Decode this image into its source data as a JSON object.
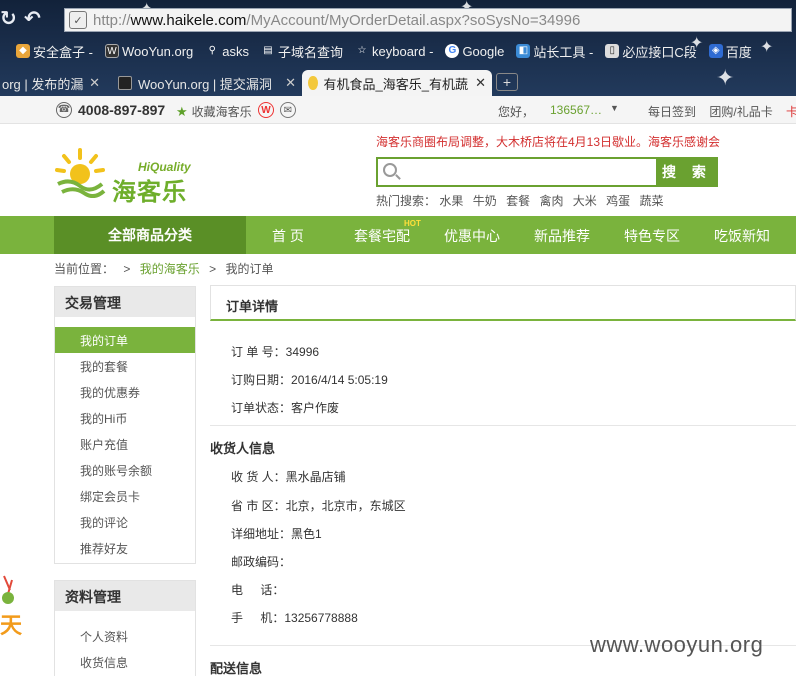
{
  "browser": {
    "url_prefix": "http://",
    "url_host": "www.haikele.com",
    "url_path": "/MyAccount/MyOrderDetail.aspx?soSysNo=34996",
    "bookmarks": [
      "安全盒子 -",
      "WooYun.org",
      "asks",
      "子域名查询",
      "keyboard -",
      "Google",
      "站长工具 -",
      "必应接口C段",
      "百度"
    ],
    "tabs": [
      {
        "label": "org | 发布的漏",
        "active": false
      },
      {
        "label": "WooYun.org | 提交漏洞",
        "active": false
      },
      {
        "label": "有机食品_海客乐_有机蔬",
        "active": true
      }
    ],
    "new_tab": "+",
    "close_glyph": "✕"
  },
  "topbar": {
    "phone": "4008-897-897",
    "favorite": "收藏海客乐",
    "greeting": "您好，",
    "username": "136567…",
    "links": [
      "每日签到",
      "团购/礼品卡",
      "卡"
    ]
  },
  "header": {
    "logo_latin": "HiQuality",
    "logo_cn": "海客乐",
    "notice": "海客乐商圈布局调整，大木桥店将在4月13日歇业。海客乐感谢会",
    "search_button": "搜 索",
    "hot_label": "热门搜索：",
    "hot_terms": [
      "水果",
      "牛奶",
      "套餐",
      "禽肉",
      "大米",
      "鸡蛋",
      "蔬菜"
    ]
  },
  "nav": {
    "all_categories": "全部商品分类",
    "items": [
      "首 页",
      "套餐宅配",
      "优惠中心",
      "新品推荐",
      "特色专区",
      "吃饭新知"
    ],
    "hot_badge": "HOT"
  },
  "breadcrumb": {
    "label": "当前位置：",
    "sep": ">",
    "level1": "我的海客乐",
    "level2": "我的订单"
  },
  "sidebar": {
    "trade_title": "交易管理",
    "trade_items": [
      "我的订单",
      "我的套餐",
      "我的优惠券",
      "我的Hi币",
      "账户充值",
      "我的账号余额",
      "绑定会员卡",
      "我的评论",
      "推荐好友"
    ],
    "profile_title": "资料管理",
    "profile_items": [
      "个人资料",
      "收货信息"
    ]
  },
  "order": {
    "panel_title": "订单详情",
    "order_no_label": "订 单 号：",
    "order_no": "34996",
    "order_date_label": "订购日期：",
    "order_date": "2016/4/14 5:05:19",
    "order_status_label": "订单状态：",
    "order_status": "客户作废",
    "receiver_section": "收货人信息",
    "receiver_label": "收 货 人：",
    "receiver": "黑水晶店铺",
    "region_label": "省 市 区：",
    "region": "北京，北京市，东城区",
    "address_label": "详细地址：",
    "address": "黑色1",
    "zip_label": "邮政编码：",
    "zip": "",
    "tel_label": "电 话：",
    "tel": "",
    "mobile_label": "手 机：",
    "mobile": "13256778888",
    "delivery_section": "配送信息"
  },
  "left_widget": {
    "text": "天"
  },
  "watermark": "www.wooyun.org",
  "colors": {
    "brand_green": "#7ab33d",
    "dark_green": "#5a8f26",
    "notice_red": "#d32f2f"
  }
}
